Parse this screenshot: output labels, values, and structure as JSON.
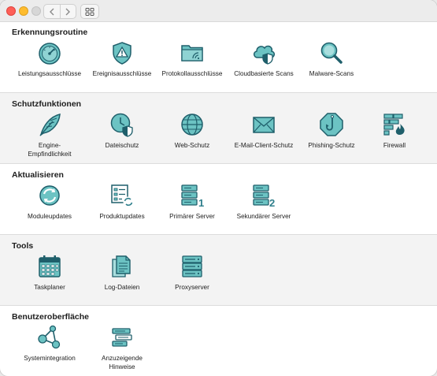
{
  "window": {
    "title": ""
  },
  "sections": [
    {
      "title": "Erkennungsroutine",
      "items": [
        {
          "label": "Leistungsausschlüsse",
          "icon": "gauge-icon"
        },
        {
          "label": "Ereignisausschlüsse",
          "icon": "warning-shield-icon"
        },
        {
          "label": "Protokollausschlüsse",
          "icon": "folder-signal-icon"
        },
        {
          "label": "Cloudbasierte Scans",
          "icon": "cloud-shield-icon"
        },
        {
          "label": "Malware-Scans",
          "icon": "magnifier-icon"
        }
      ]
    },
    {
      "title": "Schutzfunktionen",
      "items": [
        {
          "label": "Engine-Empfindlichkeit",
          "icon": "feather-icon"
        },
        {
          "label": "Dateischutz",
          "icon": "clock-shield-icon"
        },
        {
          "label": "Web-Schutz",
          "icon": "globe-icon"
        },
        {
          "label": "E-Mail-Client-Schutz",
          "icon": "envelope-icon"
        },
        {
          "label": "Phishing-Schutz",
          "icon": "hook-octagon-icon"
        },
        {
          "label": "Firewall",
          "icon": "firewall-icon"
        }
      ]
    },
    {
      "title": "Aktualisieren",
      "items": [
        {
          "label": "Moduleupdates",
          "icon": "refresh-circle-icon"
        },
        {
          "label": "Produktupdates",
          "icon": "list-refresh-icon"
        },
        {
          "label": "Primärer Server",
          "icon": "server-one-icon"
        },
        {
          "label": "Sekundärer Server",
          "icon": "server-two-icon"
        }
      ]
    },
    {
      "title": "Tools",
      "items": [
        {
          "label": "Taskplaner",
          "icon": "calendar-icon"
        },
        {
          "label": "Log-Dateien",
          "icon": "documents-icon"
        },
        {
          "label": "Proxyserver",
          "icon": "server-stack-icon"
        }
      ]
    },
    {
      "title": "Benutzeroberfläche",
      "items": [
        {
          "label": "Systemintegration",
          "icon": "network-nodes-icon"
        },
        {
          "label": "Anzuzeigende Hinweise",
          "icon": "hints-list-icon"
        }
      ]
    }
  ],
  "colors": {
    "icon_fill": "#5fb8b8",
    "icon_stroke": "#1f5f6b",
    "accent": "#2f7f8c"
  }
}
